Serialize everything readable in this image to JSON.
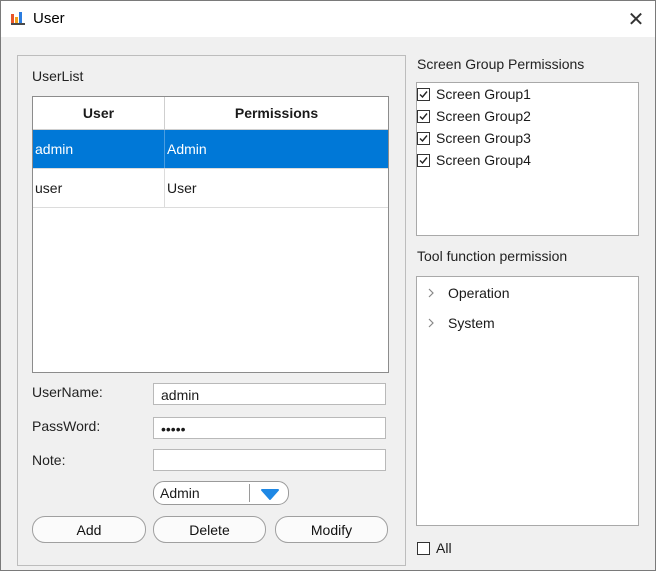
{
  "window": {
    "title": "User"
  },
  "userlist": {
    "label": "UserList",
    "columns": [
      "User",
      "Permissions"
    ],
    "rows": [
      {
        "user": "admin",
        "permission": "Admin",
        "selected": true
      },
      {
        "user": "user",
        "permission": "User",
        "selected": false
      }
    ]
  },
  "form": {
    "username_label": "UserName:",
    "username_value": "admin",
    "password_label": "PassWord:",
    "password_value": "•••••",
    "note_label": "Note:",
    "note_value": "",
    "role_value": "Admin"
  },
  "buttons": {
    "add": "Add",
    "delete": "Delete",
    "modify": "Modify"
  },
  "screen_group": {
    "label": "Screen Group Permissions",
    "items": [
      {
        "label": "Screen Group1",
        "checked": true
      },
      {
        "label": "Screen Group2",
        "checked": true
      },
      {
        "label": "Screen Group3",
        "checked": true
      },
      {
        "label": "Screen Group4",
        "checked": true
      }
    ]
  },
  "tool_function": {
    "label": "Tool function permission",
    "items": [
      {
        "label": "Operation"
      },
      {
        "label": "System"
      }
    ]
  },
  "all": {
    "label": "All",
    "checked": false
  },
  "colors": {
    "selection": "#0078d7",
    "dropdown_arrow": "#1e88e5"
  }
}
